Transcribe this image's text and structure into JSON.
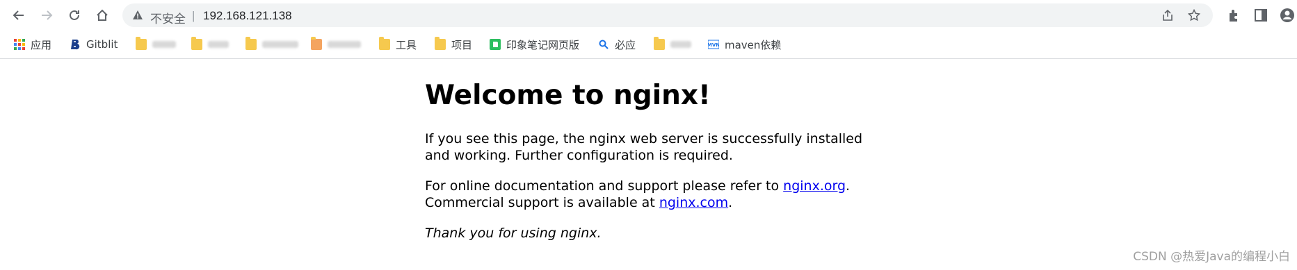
{
  "browser": {
    "security_label": "不安全",
    "separator": "|",
    "url": "192.168.121.138"
  },
  "bookmarks": [
    {
      "label": "应用",
      "icon": "apps-grid-icon"
    },
    {
      "label": "Gitblit",
      "icon": "gitblit-icon"
    },
    {
      "label": "",
      "icon": "folder-icon"
    },
    {
      "label": "",
      "icon": "folder-icon"
    },
    {
      "label": "",
      "icon": "folder-icon"
    },
    {
      "label": "",
      "icon": "orange-folder-icon"
    },
    {
      "label": "工具",
      "icon": "folder-icon"
    },
    {
      "label": "项目",
      "icon": "folder-icon"
    },
    {
      "label": "印象笔记网页版",
      "icon": "evernote-icon"
    },
    {
      "label": "必应",
      "icon": "search-icon"
    },
    {
      "label": "",
      "icon": "folder-icon"
    },
    {
      "label": "maven依赖",
      "icon": "mvn-icon"
    }
  ],
  "page": {
    "heading": "Welcome to nginx!",
    "para1": "If you see this page, the nginx web server is successfully installed and working. Further configuration is required.",
    "para2_prefix": "For online documentation and support please refer to ",
    "link_org": "nginx.org",
    "para2_mid": ".",
    "para2_line2_prefix": "Commercial support is available at ",
    "link_com": "nginx.com",
    "para2_end": ".",
    "para3": "Thank you for using nginx."
  },
  "watermark": "CSDN @热爱Java的编程小白"
}
